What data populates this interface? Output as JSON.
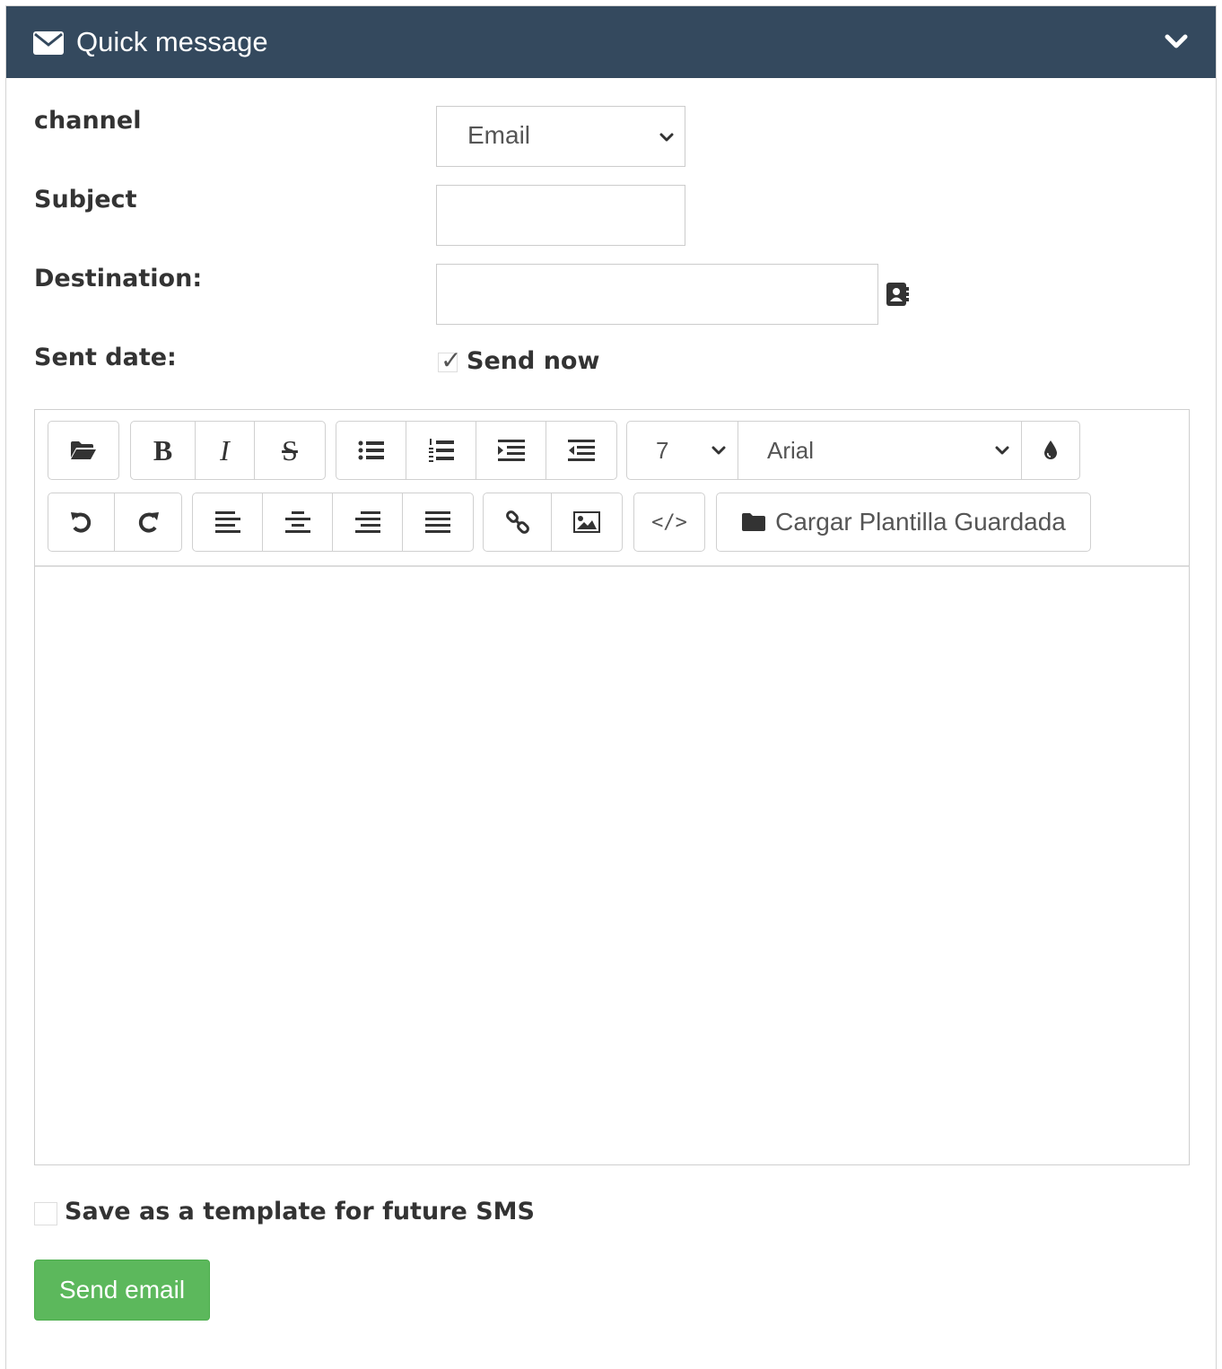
{
  "header": {
    "title": "Quick message",
    "icon": "envelope-icon",
    "collapse_icon": "chevron-down-icon"
  },
  "form": {
    "channel_label": "channel",
    "channel_value": "Email",
    "subject_label": "Subject",
    "subject_value": "",
    "destination_label": "Destination:",
    "destination_value": "",
    "sent_date_label": "Sent date:",
    "send_now_label": "Send now",
    "send_now_checked": true
  },
  "toolbar": {
    "font_size": "7",
    "font_family": "Arial",
    "template_label": "Cargar Plantilla Guardada",
    "icons": [
      "folder-open-icon",
      "bold-icon",
      "italic-icon",
      "strikethrough-icon",
      "bullet-list-icon",
      "numbered-list-icon",
      "indent-icon",
      "outdent-icon",
      "color-icon",
      "undo-icon",
      "redo-icon",
      "align-left-icon",
      "align-center-icon",
      "align-right-icon",
      "align-justify-icon",
      "link-icon",
      "image-icon",
      "code-icon",
      "folder-icon"
    ],
    "bold_glyph": "B",
    "italic_glyph": "I",
    "strike_glyph": "S",
    "code_glyph": "</>"
  },
  "footer": {
    "save_template_label": "Save as a template for future SMS",
    "save_template_checked": false,
    "send_button_label": "Send email"
  },
  "colors": {
    "header_bg": "#34495e",
    "send_button_bg": "#5cb85c"
  }
}
